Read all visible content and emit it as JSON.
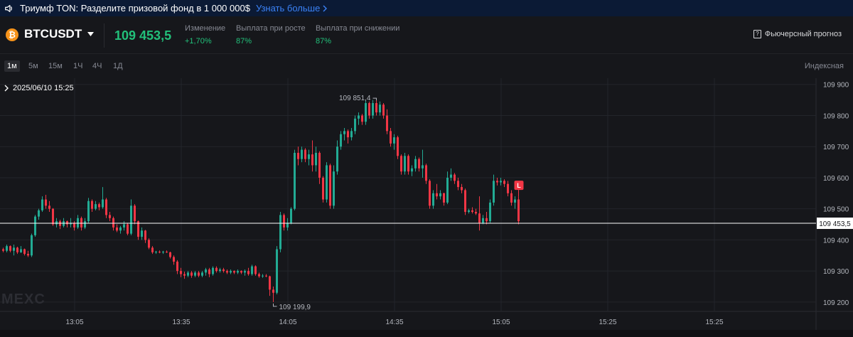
{
  "banner": {
    "text": "Триумф TON: Разделите призовой фонд в 1 000 000$",
    "link": "Узнать больше"
  },
  "header": {
    "coin_glyph": "₿",
    "symbol": "BTCUSDT",
    "price": "109 453,5",
    "stats": [
      {
        "label": "Изменение",
        "value": "+1,70%"
      },
      {
        "label": "Выплата при росте",
        "value": "87%"
      },
      {
        "label": "Выплата при снижении",
        "value": "87%"
      }
    ],
    "forecast_label": "Фьючерсный прогноз"
  },
  "timeframes": [
    "1м",
    "5м",
    "15м",
    "1Ч",
    "4Ч",
    "1Д"
  ],
  "active_timeframe": "1м",
  "index_label": "Индексная",
  "chart": {
    "datetime": "2025/06/10 15:25",
    "watermark": "MEXC",
    "colors": {
      "up": "#22ab94",
      "down": "#f23645",
      "bg": "#16171b",
      "grid": "#23252b"
    }
  },
  "chart_data": {
    "type": "candlestick",
    "y_ticks": [
      109200,
      109300,
      109400,
      109500,
      109600,
      109700,
      109800,
      109900
    ],
    "y_tick_labels": [
      "109 200",
      "109 300",
      "109 400",
      "109 500",
      "109 600",
      "109 700",
      "109 800",
      "109 900"
    ],
    "ylim": [
      109170,
      109920
    ],
    "x_ticks": [
      "13:05",
      "13:35",
      "14:05",
      "14:35",
      "15:05",
      "15:25",
      "15:25"
    ],
    "current_price": 109453.5,
    "current_price_label": "109 453,5",
    "high_label": "109 851,4",
    "low_label": "109 199,9",
    "position_marker": "L",
    "candles": [
      [
        109370,
        109375,
        109360,
        109365
      ],
      [
        109365,
        109385,
        109360,
        109380
      ],
      [
        109380,
        109382,
        109360,
        109365
      ],
      [
        109365,
        109385,
        109350,
        109375
      ],
      [
        109375,
        109378,
        109355,
        109360
      ],
      [
        109360,
        109380,
        109358,
        109370
      ],
      [
        109370,
        109372,
        109350,
        109355
      ],
      [
        109355,
        109365,
        109345,
        109350
      ],
      [
        109350,
        109420,
        109345,
        109415
      ],
      [
        109415,
        109480,
        109410,
        109475
      ],
      [
        109475,
        109500,
        109465,
        109495
      ],
      [
        109495,
        109540,
        109490,
        109530
      ],
      [
        109530,
        109545,
        109500,
        109510
      ],
      [
        109510,
        109525,
        109490,
        109500
      ],
      [
        109500,
        109502,
        109445,
        109450
      ],
      [
        109450,
        109470,
        109440,
        109460
      ],
      [
        109460,
        109465,
        109435,
        109445
      ],
      [
        109445,
        109470,
        109440,
        109460
      ],
      [
        109460,
        109462,
        109440,
        109450
      ],
      [
        109450,
        109470,
        109440,
        109455
      ],
      [
        109455,
        109460,
        109430,
        109440
      ],
      [
        109440,
        109480,
        109435,
        109470
      ],
      [
        109470,
        109475,
        109430,
        109440
      ],
      [
        109440,
        109470,
        109435,
        109460
      ],
      [
        109460,
        109535,
        109455,
        109525
      ],
      [
        109525,
        109530,
        109490,
        109500
      ],
      [
        109500,
        109525,
        109495,
        109515
      ],
      [
        109515,
        109520,
        109495,
        109505
      ],
      [
        109505,
        109570,
        109500,
        109530
      ],
      [
        109530,
        109535,
        109470,
        109480
      ],
      [
        109480,
        109490,
        109460,
        109470
      ],
      [
        109470,
        109475,
        109430,
        109440
      ],
      [
        109440,
        109450,
        109425,
        109430
      ],
      [
        109430,
        109445,
        109420,
        109440
      ],
      [
        109440,
        109460,
        109430,
        109450
      ],
      [
        109450,
        109455,
        109415,
        109420
      ],
      [
        109420,
        109530,
        109415,
        109510
      ],
      [
        109510,
        109515,
        109450,
        109460
      ],
      [
        109460,
        109462,
        109400,
        109410
      ],
      [
        109410,
        109440,
        109400,
        109430
      ],
      [
        109430,
        109432,
        109390,
        109400
      ],
      [
        109400,
        109405,
        109370,
        109375
      ],
      [
        109375,
        109380,
        109355,
        109360
      ],
      [
        109360,
        109365,
        109355,
        109362
      ],
      [
        109362,
        109366,
        109357,
        109360
      ],
      [
        109360,
        109365,
        109355,
        109362
      ],
      [
        109362,
        109366,
        109358,
        109360
      ],
      [
        109360,
        109362,
        109340,
        109345
      ],
      [
        109345,
        109350,
        109320,
        109330
      ],
      [
        109330,
        109335,
        109290,
        109300
      ],
      [
        109300,
        109310,
        109280,
        109290
      ],
      [
        109290,
        109298,
        109275,
        109285
      ],
      [
        109285,
        109300,
        109280,
        109295
      ],
      [
        109295,
        109300,
        109278,
        109285
      ],
      [
        109285,
        109300,
        109280,
        109295
      ],
      [
        109295,
        109300,
        109280,
        109285
      ],
      [
        109285,
        109300,
        109280,
        109295
      ],
      [
        109295,
        109310,
        109285,
        109305
      ],
      [
        109305,
        109310,
        109280,
        109290
      ],
      [
        109290,
        109315,
        109285,
        109310
      ],
      [
        109310,
        109315,
        109295,
        109300
      ],
      [
        109300,
        109310,
        109295,
        109305
      ],
      [
        109305,
        109310,
        109295,
        109300
      ],
      [
        109300,
        109305,
        109290,
        109295
      ],
      [
        109295,
        109305,
        109290,
        109300
      ],
      [
        109300,
        109302,
        109290,
        109295
      ],
      [
        109295,
        109305,
        109290,
        109300
      ],
      [
        109300,
        109302,
        109290,
        109295
      ],
      [
        109295,
        109305,
        109285,
        109300
      ],
      [
        109300,
        109310,
        109285,
        109290
      ],
      [
        109290,
        109320,
        109285,
        109315
      ],
      [
        109315,
        109318,
        109285,
        109290
      ],
      [
        109290,
        109295,
        109278,
        109283
      ],
      [
        109283,
        109290,
        109278,
        109285
      ],
      [
        109285,
        109290,
        109280,
        109283
      ],
      [
        109283,
        109285,
        109220,
        109240
      ],
      [
        109240,
        109250,
        109200,
        109230
      ],
      [
        109230,
        109380,
        109225,
        109370
      ],
      [
        109370,
        109490,
        109360,
        109480
      ],
      [
        109480,
        109485,
        109430,
        109440
      ],
      [
        109440,
        109470,
        109430,
        109455
      ],
      [
        109455,
        109505,
        109450,
        109500
      ],
      [
        109500,
        109690,
        109495,
        109680
      ],
      [
        109680,
        109700,
        109640,
        109660
      ],
      [
        109660,
        109700,
        109650,
        109690
      ],
      [
        109690,
        109695,
        109650,
        109660
      ],
      [
        109660,
        109690,
        109640,
        109675
      ],
      [
        109675,
        109720,
        109620,
        109640
      ],
      [
        109640,
        109700,
        109620,
        109680
      ],
      [
        109680,
        109685,
        109580,
        109600
      ],
      [
        109600,
        109605,
        109520,
        109530
      ],
      [
        109530,
        109650,
        109520,
        109640
      ],
      [
        109640,
        109645,
        109500,
        109510
      ],
      [
        109510,
        109640,
        109500,
        109620
      ],
      [
        109620,
        109720,
        109610,
        109700
      ],
      [
        109700,
        109750,
        109690,
        109740
      ],
      [
        109740,
        109760,
        109720,
        109750
      ],
      [
        109750,
        109755,
        109710,
        109730
      ],
      [
        109730,
        109760,
        109720,
        109750
      ],
      [
        109750,
        109800,
        109740,
        109790
      ],
      [
        109790,
        109810,
        109770,
        109800
      ],
      [
        109800,
        109805,
        109770,
        109780
      ],
      [
        109780,
        109850,
        109770,
        109840
      ],
      [
        109840,
        109845,
        109790,
        109800
      ],
      [
        109800,
        109850,
        109790,
        109840
      ],
      [
        109840,
        109851,
        109800,
        109810
      ],
      [
        109810,
        109845,
        109800,
        109835
      ],
      [
        109835,
        109840,
        109790,
        109800
      ],
      [
        109800,
        109820,
        109740,
        109750
      ],
      [
        109750,
        109760,
        109700,
        109710
      ],
      [
        109710,
        109740,
        109690,
        109730
      ],
      [
        109730,
        109735,
        109660,
        109670
      ],
      [
        109670,
        109675,
        109610,
        109620
      ],
      [
        109620,
        109680,
        109610,
        109670
      ],
      [
        109670,
        109675,
        109610,
        109620
      ],
      [
        109620,
        109640,
        109605,
        109630
      ],
      [
        109630,
        109670,
        109620,
        109660
      ],
      [
        109660,
        109665,
        109620,
        109630
      ],
      [
        109630,
        109690,
        109600,
        109640
      ],
      [
        109640,
        109645,
        109580,
        109590
      ],
      [
        109590,
        109595,
        109500,
        109510
      ],
      [
        109510,
        109560,
        109500,
        109550
      ],
      [
        109550,
        109580,
        109530,
        109540
      ],
      [
        109540,
        109560,
        109530,
        109550
      ],
      [
        109550,
        109552,
        109510,
        109520
      ],
      [
        109520,
        109620,
        109515,
        109600
      ],
      [
        109600,
        109630,
        109590,
        109610
      ],
      [
        109610,
        109615,
        109580,
        109590
      ],
      [
        109590,
        109600,
        109560,
        109570
      ],
      [
        109570,
        109580,
        109550,
        109560
      ],
      [
        109560,
        109565,
        109480,
        109490
      ],
      [
        109490,
        109500,
        109485,
        109495
      ],
      [
        109495,
        109505,
        109485,
        109490
      ],
      [
        109490,
        109500,
        109480,
        109485
      ],
      [
        109485,
        109540,
        109430,
        109455
      ],
      [
        109455,
        109480,
        109450,
        109470
      ],
      [
        109470,
        109490,
        109450,
        109460
      ],
      [
        109460,
        109530,
        109455,
        109520
      ],
      [
        109520,
        109610,
        109510,
        109590
      ],
      [
        109590,
        109600,
        109575,
        109585
      ],
      [
        109585,
        109600,
        109575,
        109590
      ],
      [
        109590,
        109595,
        109570,
        109580
      ],
      [
        109580,
        109590,
        109540,
        109550
      ],
      [
        109550,
        109560,
        109510,
        109520
      ],
      [
        109520,
        109540,
        109500,
        109530
      ],
      [
        109530,
        109540,
        109450,
        109460
      ]
    ]
  }
}
